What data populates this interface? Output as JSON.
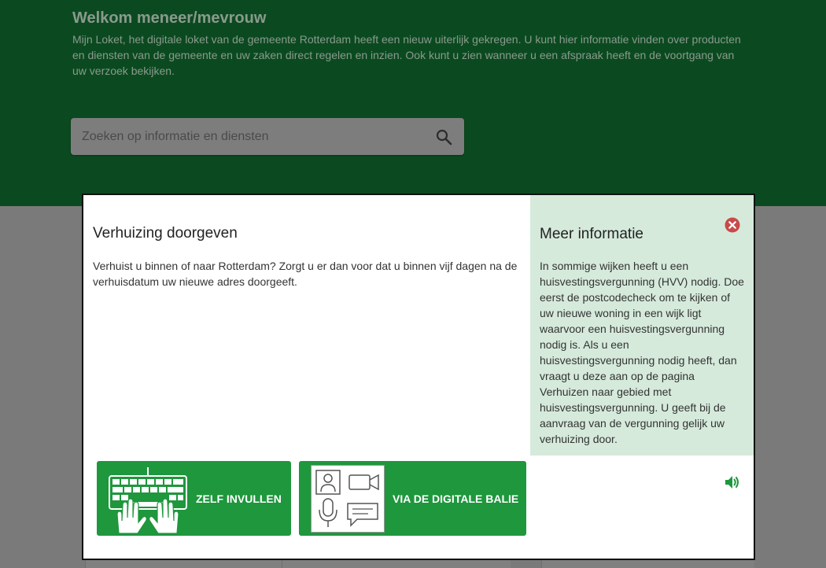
{
  "hero": {
    "title": "Welkom meneer/mevrouw",
    "intro": "Mijn Loket, het digitale loket van de gemeente Rotterdam heeft een nieuw uiterlijk gekregen. U kunt hier informatie vinden over producten en diensten van de gemeente en uw zaken direct regelen en inzien. Ook kunt u zien wanneer u een afspraak heeft en de voortgang van uw verzoek bekijken."
  },
  "search": {
    "placeholder": "Zoeken op informatie en diensten",
    "icon": "search-icon"
  },
  "modal": {
    "title": "Verhuizing doorgeven",
    "description": "Verhuist u binnen of naar Rotterdam? Zorgt u er dan voor dat u binnen vijf dagen na de verhuisdatum uw nieuwe adres doorgeeft.",
    "info_title": "Meer informatie",
    "info_text": "In sommige wijken heeft u een huisvestingsvergunning (HVV) nodig. Doe eerst de postcodecheck om te kijken of uw nieuwe woning in een wijk ligt waarvoor een huisvestingsvergunning nodig is. Als u een huisvestingsvergunning nodig heeft, dan vraagt u deze aan op de pagina Verhuizen naar gebied met huisvestingsvergunning. U geeft bij de aanvraag van de vergunning gelijk uw verhuizing door.",
    "buttons": {
      "self_label": "ZELF INVULLEN",
      "balie_label": "VIA DE DIGITALE BALIE"
    },
    "icons": [
      "close-icon",
      "speaker-icon",
      "keyboard-hands-icon",
      "digital-counter-icon"
    ]
  },
  "colors": {
    "hero_bg": "#0b4a20",
    "button_green": "#1e973d",
    "info_panel": "#d5eadb",
    "close_red": "#c94a4a",
    "overlay_grey": "#7a7a7a"
  }
}
